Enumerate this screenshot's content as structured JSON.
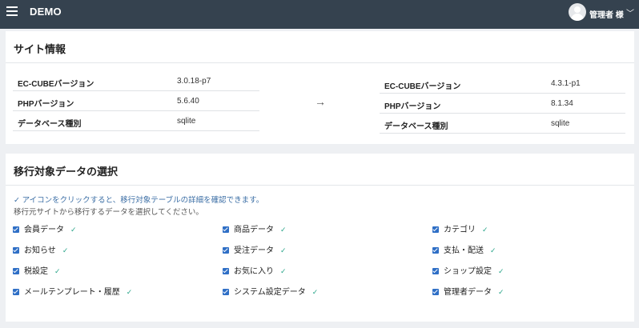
{
  "header": {
    "brand": "DEMO",
    "user_name": "管理者 様",
    "chevron": "﹀"
  },
  "site_info": {
    "title": "サイト情報",
    "arrow": "→",
    "source": [
      {
        "label": "EC-CUBEバージョン",
        "value": "3.0.18-p7"
      },
      {
        "label": "PHPバージョン",
        "value": "5.6.40"
      },
      {
        "label": "データベース種別",
        "value": "sqlite"
      }
    ],
    "target": [
      {
        "label": "EC-CUBEバージョン",
        "value": "4.3.1-p1"
      },
      {
        "label": "PHPバージョン",
        "value": "8.1.34"
      },
      {
        "label": "データベース種別",
        "value": "sqlite"
      }
    ]
  },
  "migration": {
    "title": "移行対象データの選択",
    "note_check": "✓ アイコンをクリックすると、移行対象テーブルの詳細を確認できます。",
    "note_select": "移行元サイトから移行するデータを選択してください。",
    "tick": "✓",
    "options": [
      {
        "label": "会員データ",
        "checked": true
      },
      {
        "label": "商品データ",
        "checked": true
      },
      {
        "label": "カテゴリ",
        "checked": true
      },
      {
        "label": "お知らせ",
        "checked": true
      },
      {
        "label": "受注データ",
        "checked": true
      },
      {
        "label": "支払・配送",
        "checked": true
      },
      {
        "label": "税設定",
        "checked": true
      },
      {
        "label": "お気に入り",
        "checked": true
      },
      {
        "label": "ショップ設定",
        "checked": true
      },
      {
        "label": "メールテンプレート・履歴",
        "checked": true
      },
      {
        "label": "システム設定データ",
        "checked": true
      },
      {
        "label": "管理者データ",
        "checked": true
      }
    ]
  },
  "colors": {
    "topbar": "#35424f",
    "checkbox": "#2f6fc6",
    "tick": "#2aa58a",
    "note_link": "#3b6ea5"
  }
}
